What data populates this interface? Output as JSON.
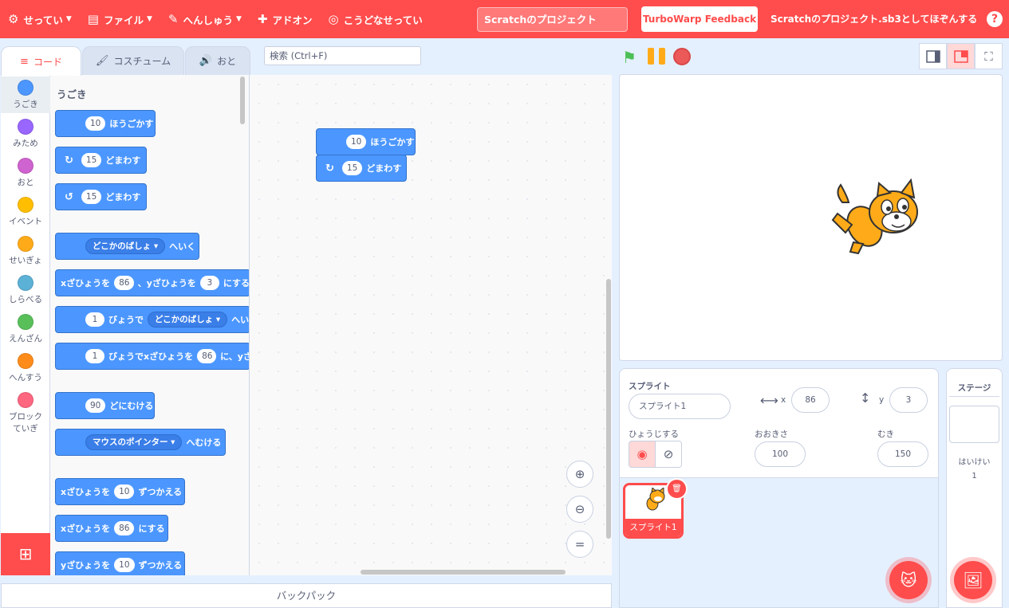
{
  "menubar": {
    "settings": "せってい",
    "file": "ファイル",
    "edit": "へんしゅう",
    "addons": "アドオン",
    "advanced": "こうどなせってい",
    "project_title": "Scratchのプロジェクト",
    "feedback": "TurboWarp Feedback",
    "save": "Scratchのプロジェクト.sb3としてほぞんする",
    "help": "?"
  },
  "tabs": {
    "code": "コード",
    "costumes": "コスチューム",
    "sounds": "おと"
  },
  "search": {
    "placeholder": "検索 (Ctrl+F)"
  },
  "categories": [
    {
      "label": "うごき",
      "color": "#4c97ff"
    },
    {
      "label": "みため",
      "color": "#9966ff"
    },
    {
      "label": "おと",
      "color": "#cf63cf"
    },
    {
      "label": "イベント",
      "color": "#ffbf00"
    },
    {
      "label": "せいぎょ",
      "color": "#ffab19"
    },
    {
      "label": "しらべる",
      "color": "#5cb1d6"
    },
    {
      "label": "えんざん",
      "color": "#59c059"
    },
    {
      "label": "へんすう",
      "color": "#ff8c1a"
    },
    {
      "label": "ブロックていぎ",
      "color": "#ff6680"
    }
  ],
  "flyout": {
    "heading": "うごき",
    "move": {
      "value": "10",
      "text": "ほうごかす"
    },
    "turn_right": {
      "value": "15",
      "text": "どまわす"
    },
    "turn_left": {
      "value": "15",
      "text": "どまわす"
    },
    "goto": {
      "menu": "どこかのばしょ",
      "text": "へいく"
    },
    "goto_xy": {
      "pre": "xざひょうを",
      "x": "86",
      "mid": "、yざひょうを",
      "y": "3",
      "post": "にする"
    },
    "glide": {
      "secs": "1",
      "text": "びょうで",
      "menu": "どこかのばしょ",
      "post": "へい"
    },
    "glide_xy": {
      "secs": "1",
      "text": "びょうでxざひょうを",
      "x": "86",
      "post": "に、yざ"
    },
    "point_dir": {
      "value": "90",
      "text": "どにむける"
    },
    "point_towards": {
      "menu": "マウスのポインター",
      "text": "へむける"
    },
    "change_x": {
      "pre": "xざひょうを",
      "value": "10",
      "post": "ずつかえる"
    },
    "set_x": {
      "pre": "xざひょうを",
      "value": "86",
      "post": "にする"
    },
    "change_y": {
      "pre": "yざひょうを",
      "value": "10",
      "post": "ずつかえる"
    }
  },
  "script": {
    "move": {
      "value": "10",
      "text": "ほうごかす"
    },
    "turn": {
      "value": "15",
      "text": "どまわす"
    }
  },
  "backpack": "バックパック",
  "sprite_info": {
    "sprite_label": "スプライト",
    "sprite_name": "スプライト1",
    "x_label": "x",
    "x": "86",
    "y_label": "y",
    "y": "3",
    "show_label": "ひょうじする",
    "size_label": "おおきさ",
    "size": "100",
    "direction_label": "むき",
    "direction": "150"
  },
  "sprite_list": [
    {
      "name": "スプライト1"
    }
  ],
  "stage_pane": {
    "title": "ステージ",
    "backdrops_label": "はいけい",
    "backdrops_count": "1"
  },
  "colors": {
    "accent": "#ff4c4c",
    "motion": "#4c97ff",
    "bg": "#e5f0ff"
  }
}
